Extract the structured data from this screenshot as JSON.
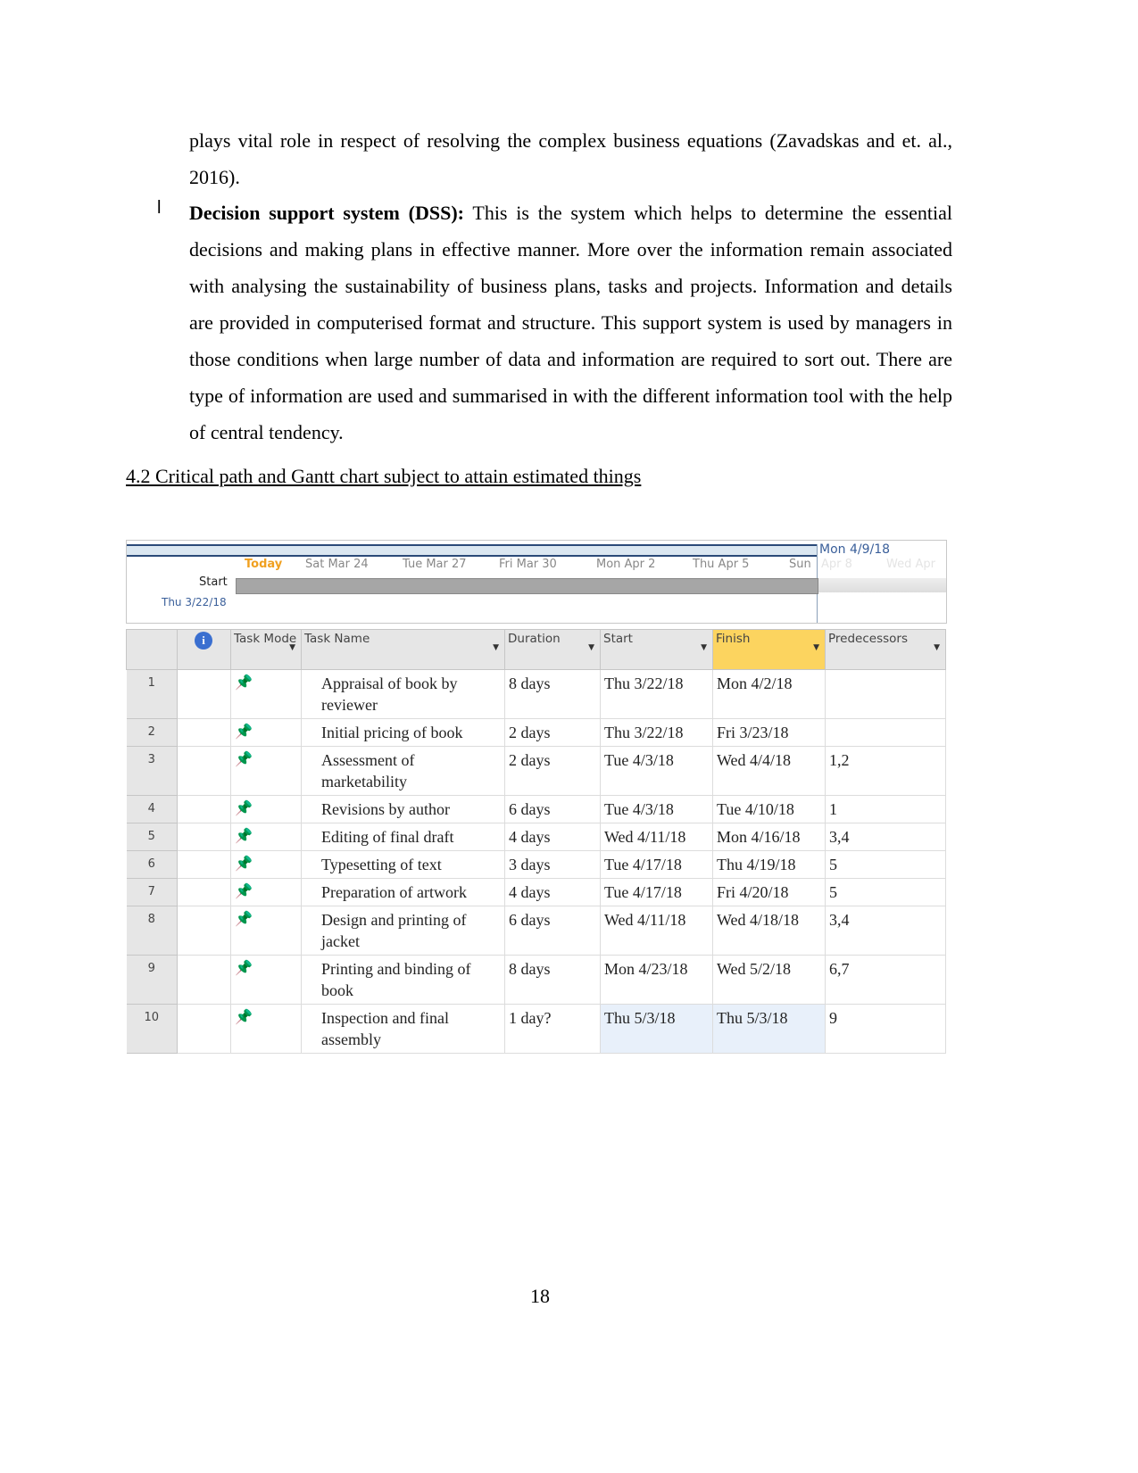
{
  "para1": "plays vital role in respect of resolving the complex business equations (Zavadskas and et. al., 2016).",
  "bullet_char": "l",
  "dss_term": "Decision support system (DSS):",
  "dss_text": " This is the system which helps to determine the essential decisions and making plans in effective manner. More over the information remain associated with analysing the sustainability of business plans, tasks and projects. Information and details are provided in computerised format and structure. This support system is used by managers in those conditions when large number of data and information are required to sort out. There are type of information are used and summarised in with the different information tool with the help of central tendency.",
  "heading": "4.2 Critical path and Gantt chart subject to attain estimated things",
  "timeline": {
    "today": "Today",
    "dates": [
      "Sat Mar 24",
      "Tue Mar 27",
      "Fri Mar 30",
      "Mon Apr 2",
      "Thu Apr 5",
      "Sun"
    ],
    "faded": [
      "Apr 8",
      "Wed Apr"
    ],
    "start_label": "Start",
    "start_date": "Thu 3/22/18",
    "finish_date": "Mon 4/9/18",
    "today_color": "#f0a020"
  },
  "columns": {
    "info": "i",
    "mode": "Task Mode",
    "name": "Task Name",
    "duration": "Duration",
    "start": "Start",
    "finish": "Finish",
    "pred": "Predecessors"
  },
  "tasks": [
    {
      "id": "1",
      "name": "Appraisal of book by reviewer",
      "duration": "8 days",
      "start": "Thu 3/22/18",
      "finish": "Mon 4/2/18",
      "pred": ""
    },
    {
      "id": "2",
      "name": "Initial pricing of book",
      "duration": "2 days",
      "start": "Thu 3/22/18",
      "finish": "Fri 3/23/18",
      "pred": ""
    },
    {
      "id": "3",
      "name": "Assessment of marketability",
      "duration": "2 days",
      "start": "Tue 4/3/18",
      "finish": "Wed 4/4/18",
      "pred": "1,2"
    },
    {
      "id": "4",
      "name": "Revisions by author",
      "duration": "6 days",
      "start": "Tue 4/3/18",
      "finish": "Tue 4/10/18",
      "pred": "1"
    },
    {
      "id": "5",
      "name": "Editing of final draft",
      "duration": "4 days",
      "start": "Wed 4/11/18",
      "finish": "Mon 4/16/18",
      "pred": "3,4"
    },
    {
      "id": "6",
      "name": "Typesetting of text",
      "duration": "3 days",
      "start": "Tue 4/17/18",
      "finish": "Thu 4/19/18",
      "pred": "5"
    },
    {
      "id": "7",
      "name": "Preparation of artwork",
      "duration": "4 days",
      "start": "Tue 4/17/18",
      "finish": "Fri 4/20/18",
      "pred": "5"
    },
    {
      "id": "8",
      "name": "Design and printing of jacket",
      "duration": "6 days",
      "start": "Wed 4/11/18",
      "finish": "Wed 4/18/18",
      "pred": "3,4"
    },
    {
      "id": "9",
      "name": "Printing and binding of book",
      "duration": "8 days",
      "start": "Mon 4/23/18",
      "finish": "Wed 5/2/18",
      "pred": "6,7"
    },
    {
      "id": "10",
      "name": "Inspection and final assembly",
      "duration": "1 day?",
      "start": "Thu 5/3/18",
      "finish": "Thu 5/3/18",
      "pred": "9"
    }
  ],
  "task_mode_icon": "pushpin-icon",
  "page_number": "18"
}
